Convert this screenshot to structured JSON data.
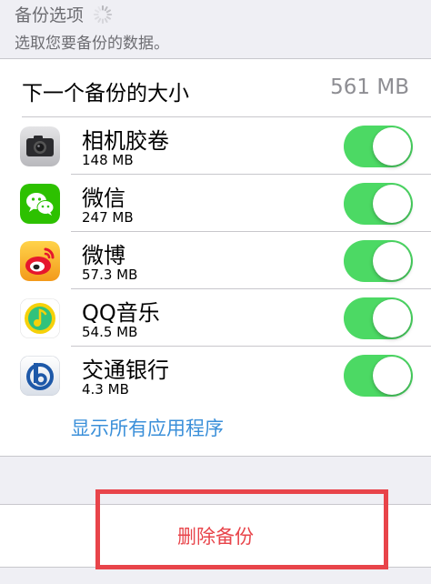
{
  "header": {
    "title": "备份选项",
    "subtitle": "选取您要备份的数据。"
  },
  "backup_size": {
    "label": "下一个备份的大小",
    "value": "561 MB"
  },
  "apps": [
    {
      "name": "相机胶卷",
      "size": "148 MB",
      "icon": "camera-icon",
      "enabled": true
    },
    {
      "name": "微信",
      "size": "247 MB",
      "icon": "wechat-icon",
      "enabled": true
    },
    {
      "name": "微博",
      "size": "57.3 MB",
      "icon": "weibo-icon",
      "enabled": true
    },
    {
      "name": "QQ音乐",
      "size": "54.5 MB",
      "icon": "qqmusic-icon",
      "enabled": true
    },
    {
      "name": "交通银行",
      "size": "4.3 MB",
      "icon": "bankcomm-icon",
      "enabled": true
    }
  ],
  "show_all_label": "显示所有应用程序",
  "delete_label": "删除备份",
  "colors": {
    "toggle_on": "#4cd964",
    "link": "#3a8fd9",
    "destructive": "#e8444a",
    "highlight_box": "#e8444a"
  }
}
